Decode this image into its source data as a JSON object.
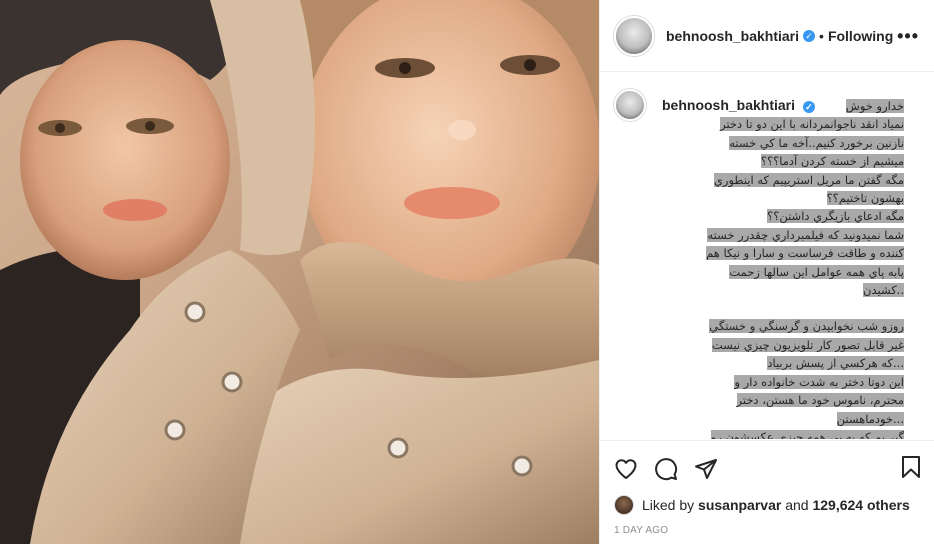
{
  "post": {
    "username": "behnoosh_bakhtiari",
    "verified_glyph": "✓",
    "follow_separator": "•",
    "follow_state": "Following",
    "more_glyph": "•••"
  },
  "caption": {
    "username": "behnoosh_bakhtiari",
    "lines": [
      "خدارو خوش",
      "نمياد انقد ناجوانمردانه با اين دو تا دختر",
      "نازنين برخورد كنيم..آخه ما كي خسته",
      "ميشيم از خسته كردن آدما؟؟؟",
      "مگه گفتن ما مريل استريپيم كه اينطوري",
      "بهشون تاختيم؟؟",
      "مگه ادعاي بازيگري داشتن؟؟",
      "شما نميدونيد كه فيلمبرداري چقدرر خسته",
      "كننده و طاقت فرساست و سارا و نيكا هم",
      "پابه پاي همه عوامل اين سالها زحمت",
      "..كشيدن",
      "",
      "روزو شب نخوابيدن و گرسنگي و خستگي",
      "غير قابل تصور كار تلويزيون چيزي نيست",
      "...كه هركسي از پسش بربياد",
      "اين دوتا دختر به شدت خانواده دار و",
      "محترم، ناموس خود ما هستن، دختر",
      "...خودماهستن",
      "گير يم كه يه بي همه چيزي عكسشون رو"
    ]
  },
  "actions": {
    "like": "heart-icon",
    "comment": "comment-icon",
    "share": "share-icon",
    "save": "bookmark-icon"
  },
  "likes": {
    "prefix": "Liked by",
    "user": "susanparvar",
    "conjunction": "and",
    "others": "129,624 others"
  },
  "timestamp": "1 DAY AGO",
  "colors": {
    "verified": "#3897f0",
    "caption_highlight": "#a9a9a9",
    "border": "#efefef",
    "muted": "#8e8e8e"
  }
}
